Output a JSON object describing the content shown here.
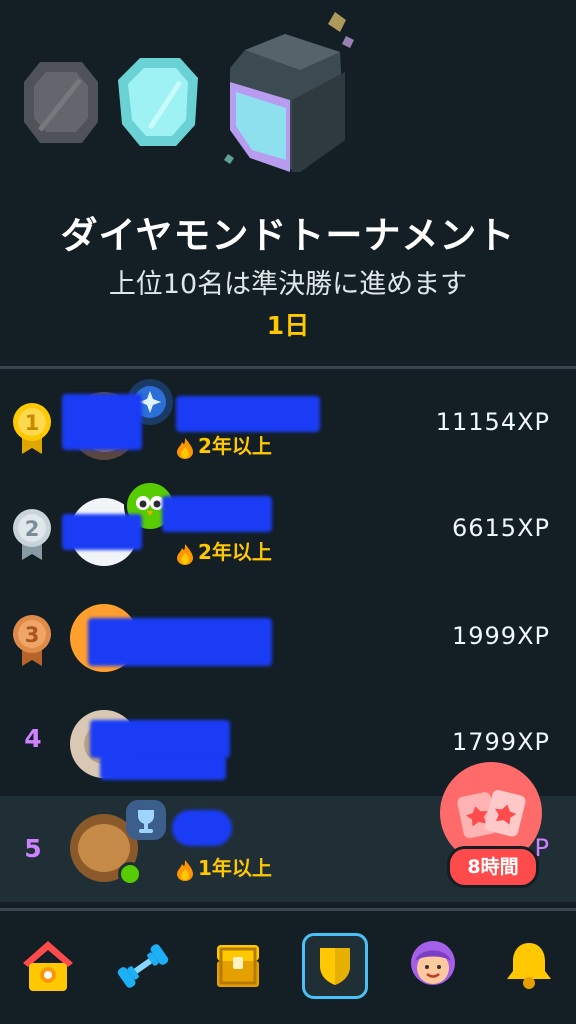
{
  "header": {
    "gems": [
      "silver-gem-icon",
      "cyan-gem-icon",
      "diamond-gem-icon"
    ],
    "title": "ダイヤモンドトーナメント",
    "subtitle": "上位10名は準決勝に進めます",
    "time_left": "1日"
  },
  "leaderboard": [
    {
      "rank": "1",
      "rank_badge": "gold-medal-icon",
      "streak": "2年以上",
      "xp": "11154XP"
    },
    {
      "rank": "2",
      "rank_badge": "silver-medal-icon",
      "streak": "2年以上",
      "xp": "6615XP"
    },
    {
      "rank": "3",
      "rank_badge": "bronze-medal-icon",
      "streak": "",
      "xp": "1999XP"
    },
    {
      "rank": "4",
      "rank_badge": "",
      "streak": "",
      "xp": "1799XP"
    },
    {
      "rank": "5",
      "rank_badge": "",
      "streak": "1年以上",
      "xp": "P"
    }
  ],
  "floating_offer": {
    "icon": "gift-cards-icon",
    "label": "8時間"
  },
  "nav": {
    "items": [
      "home-icon",
      "practice-dumbbell-icon",
      "treasure-chest-icon",
      "leaderboard-shield-icon",
      "profile-avatar-icon",
      "notifications-bell-icon"
    ],
    "active": "leaderboard-shield-icon"
  },
  "colors": {
    "background": "#131f24",
    "accent_gold": "#ffc800",
    "accent_purple": "#ce82ff",
    "active_blue": "#49c0f8",
    "alert_red": "#ff4b4b"
  }
}
